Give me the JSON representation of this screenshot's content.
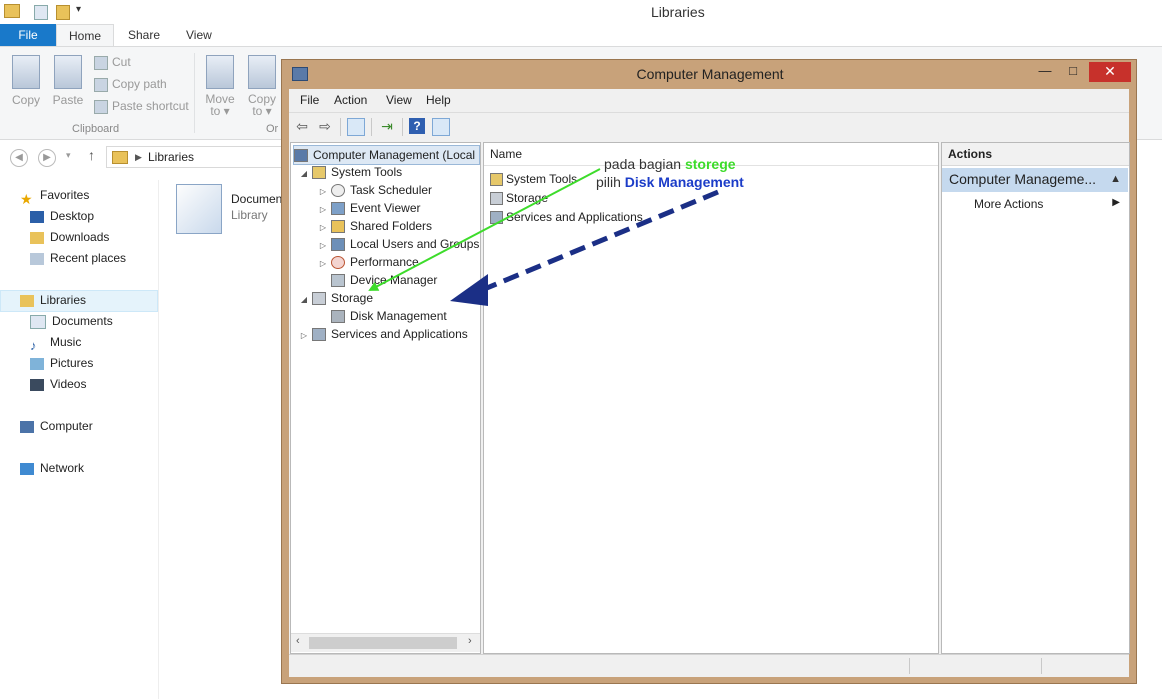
{
  "explorer": {
    "title": "Libraries",
    "tabs": [
      "File",
      "Home",
      "Share",
      "View"
    ],
    "ribbon": {
      "copy": "Copy",
      "paste": "Paste",
      "cut": "Cut",
      "copy_path": "Copy path",
      "paste_shortcut": "Paste shortcut",
      "clipboard_group": "Clipboard",
      "move_to": "Move",
      "move_to_2": "to ▾",
      "copy_to": "Copy",
      "copy_to_2": "to ▾",
      "organize_partial": "Or"
    },
    "address": {
      "path_item": "Libraries"
    },
    "nav": {
      "favorites": "Favorites",
      "desktop": "Desktop",
      "downloads": "Downloads",
      "recent": "Recent places",
      "libraries": "Libraries",
      "documents": "Documents",
      "music": "Music",
      "pictures": "Pictures",
      "videos": "Videos",
      "computer": "Computer",
      "network": "Network"
    },
    "content": {
      "item_name": "Documen",
      "item_type": "Library"
    }
  },
  "cm": {
    "title": "Computer Management",
    "close_glyph": "✕",
    "min_glyph": "—",
    "max_glyph": "□",
    "menu": [
      "File",
      "Action",
      "View",
      "Help"
    ],
    "tree": {
      "root": "Computer Management (Local",
      "system_tools": "System Tools",
      "task_scheduler": "Task Scheduler",
      "event_viewer": "Event Viewer",
      "shared_folders": "Shared Folders",
      "local_users": "Local Users and Groups",
      "performance": "Performance",
      "device_manager": "Device Manager",
      "storage": "Storage",
      "disk_management": "Disk Management",
      "services": "Services and Applications"
    },
    "list": {
      "header": "Name",
      "items": [
        "System Tools",
        "Storage",
        "Services and Applications"
      ]
    },
    "actions": {
      "header": "Actions",
      "section": "Computer Manageme...",
      "more": "More Actions"
    }
  },
  "annotation": {
    "line1_prefix": "pada bagian ",
    "line1_highlight": "storege",
    "line2_prefix": "pilih ",
    "line2_highlight": "Disk Management",
    "green_color": "#3ddc2b",
    "blue_color": "#1b2f86"
  }
}
